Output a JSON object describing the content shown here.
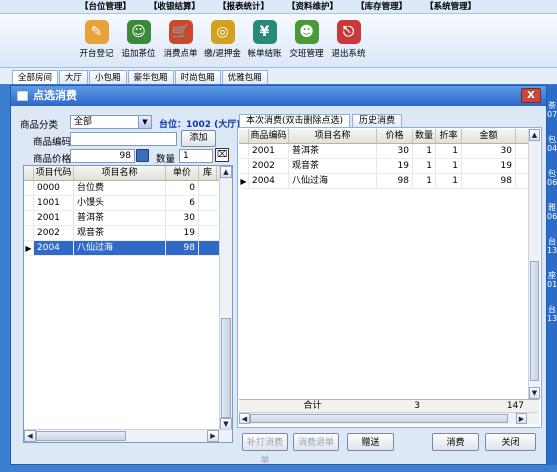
{
  "menu": [
    "【台位管理】",
    "【收银结算】",
    "【报表统计】",
    "【资料维护】",
    "【库存管理】",
    "【系统管理】"
  ],
  "toolbar": [
    {
      "label": "开台登记",
      "icon": "register-icon",
      "color": "#e8a23a"
    },
    {
      "label": "追加茶位",
      "icon": "person-add-icon",
      "color": "#3a8a3a"
    },
    {
      "label": "消费点单",
      "icon": "cart-icon",
      "color": "#c84a2a"
    },
    {
      "label": "缴/退押金",
      "icon": "coins-icon",
      "color": "#d4a020"
    },
    {
      "label": "帐单结账",
      "icon": "yen-icon",
      "color": "#2a8a7a"
    },
    {
      "label": "交班管理",
      "icon": "people-icon",
      "color": "#4a9a3a"
    },
    {
      "label": "退出系统",
      "icon": "exit-icon",
      "color": "#c83a3a"
    }
  ],
  "room_tabs": [
    "全部房间",
    "大厅",
    "小包厢",
    "豪华包厢",
    "时尚包厢",
    "优雅包厢"
  ],
  "dialog": {
    "title": "点选消费",
    "close": "X",
    "category_label": "商品分类",
    "category_value": "全部",
    "seat_info": "台位：1002 (大厅)",
    "code_label": "商品编码",
    "code_value": "",
    "add_button": "添加",
    "price_label": "商品价格",
    "price_value": "98",
    "qty_label": "数量",
    "qty_value": "1",
    "tabs": [
      "本次消费(双击删除点选)",
      "历史消费"
    ],
    "buttons": {
      "reprint": "补打消费单",
      "refund": "消费退单",
      "gift": "赠送",
      "consume": "消费",
      "close": "关闭"
    }
  },
  "product_grid": {
    "columns": [
      "项目代码",
      "项目名称",
      "单价",
      "库"
    ],
    "rows": [
      {
        "code": "0000",
        "name": "台位费",
        "price": "0"
      },
      {
        "code": "1001",
        "name": "小馒头",
        "price": "6"
      },
      {
        "code": "2001",
        "name": "普洱茶",
        "price": "30"
      },
      {
        "code": "2002",
        "name": "观音茶",
        "price": "19"
      },
      {
        "code": "2004",
        "name": "八仙过海",
        "price": "98"
      }
    ]
  },
  "order_grid": {
    "columns": [
      "商品编码",
      "项目名称",
      "价格",
      "数量",
      "折率",
      "金额"
    ],
    "rows": [
      {
        "code": "2001",
        "name": "普洱茶",
        "price": "30",
        "qty": "1",
        "rate": "1",
        "amount": "30"
      },
      {
        "code": "2002",
        "name": "观音茶",
        "price": "19",
        "qty": "1",
        "rate": "1",
        "amount": "19"
      },
      {
        "code": "2004",
        "name": "八仙过海",
        "price": "98",
        "qty": "1",
        "rate": "1",
        "amount": "98"
      }
    ],
    "total_label": "合计",
    "total_qty": "3",
    "total_amount": "147"
  },
  "side_strip": [
    "茶",
    "07",
    "包",
    "04",
    "包",
    "06",
    "雅",
    "06",
    "台",
    "13",
    "座",
    "01",
    "台",
    "13"
  ]
}
